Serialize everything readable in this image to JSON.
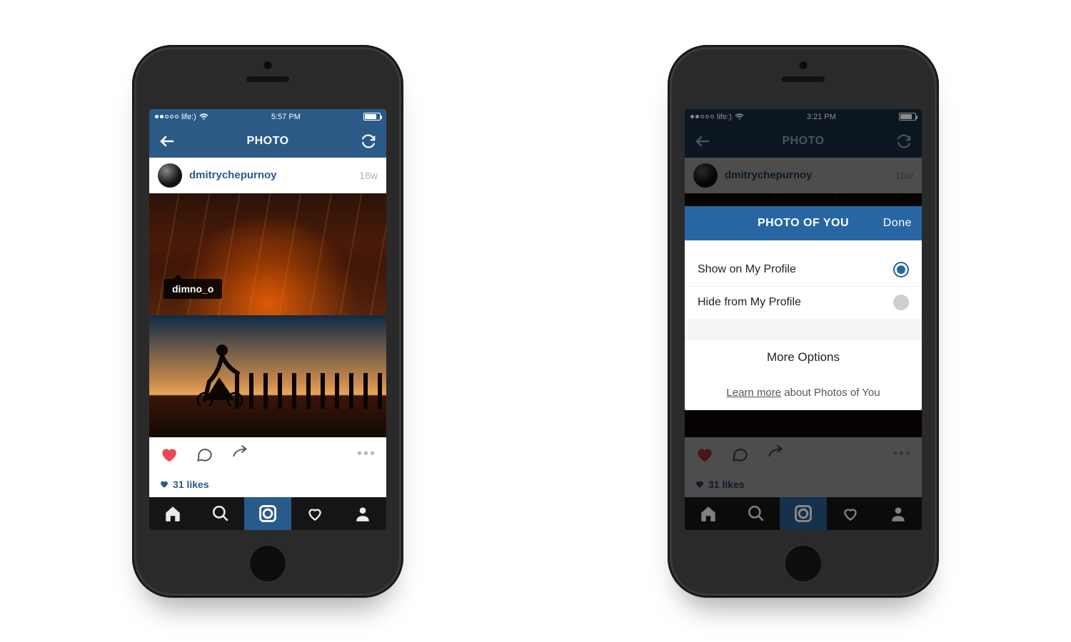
{
  "phone1": {
    "statusbar": {
      "carrier": "life:)",
      "time": "5:57 PM"
    },
    "header": {
      "title": "PHOTO"
    },
    "post": {
      "username": "dmitrychepurnoy",
      "timestamp": "16w",
      "tag_label": "dimno_o",
      "likes_count": "31 likes"
    }
  },
  "phone2": {
    "statusbar": {
      "carrier": "life:)",
      "time": "3:21 PM"
    },
    "header": {
      "title": "PHOTO"
    },
    "post": {
      "username": "dmitrychepurnoy",
      "timestamp": "16w",
      "likes_count": "31 likes"
    },
    "sheet": {
      "title": "PHOTO OF YOU",
      "done": "Done",
      "opt_show": "Show on My Profile",
      "opt_hide": "Hide from My Profile",
      "more": "More Options",
      "learn_link": "Learn more",
      "learn_tail": " about Photos of You"
    }
  }
}
